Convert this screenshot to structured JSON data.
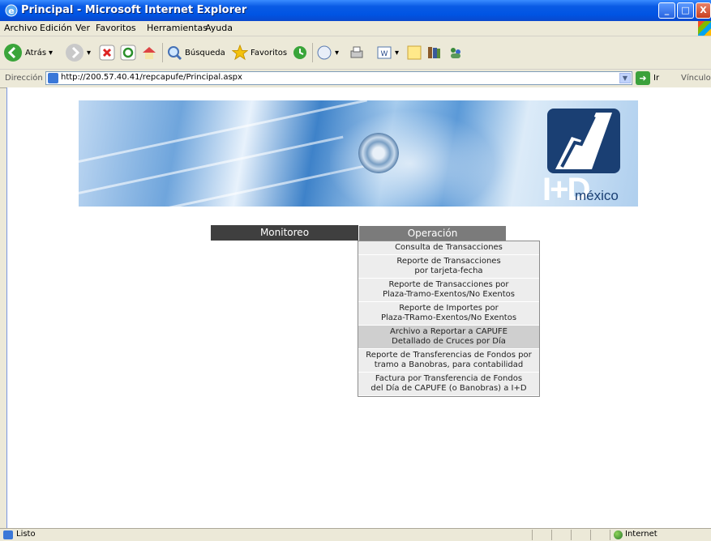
{
  "window": {
    "title": "Principal - Microsoft Internet Explorer",
    "controls": [
      "_",
      "□",
      "X"
    ]
  },
  "menubar": {
    "items": [
      "Archivo",
      "Edición",
      "Ver",
      "Favoritos",
      "Herramientas",
      "Ayuda"
    ]
  },
  "toolbar": {
    "back_label": "Atrás",
    "search_label": "Búsqueda",
    "favorites_label": "Favoritos"
  },
  "address": {
    "label": "Dirección",
    "url": "http://200.57.40.41/repcapufe/Principal.aspx",
    "go_label": "Ir",
    "links_label": "Vínculos"
  },
  "banner": {
    "logo_text": "I+D",
    "logo_sub": "méxico"
  },
  "nav": {
    "tab1": "Monitoreo",
    "tab2": "Operación",
    "dropdown": [
      {
        "line1": "Consulta de Transacciones",
        "line2": ""
      },
      {
        "line1": "Reporte de Transacciones",
        "line2": "por tarjeta-fecha"
      },
      {
        "line1": "Reporte de Transacciones por",
        "line2": "Plaza-Tramo-Exentos/No Exentos"
      },
      {
        "line1": "Reporte de Importes por",
        "line2": "Plaza-TRamo-Exentos/No Exentos"
      },
      {
        "line1": "Archivo a Reportar a CAPUFE",
        "line2": "Detallado de Cruces por Día"
      },
      {
        "line1": "Reporte de Transferencias de Fondos por",
        "line2": "tramo a Banobras, para contabilidad"
      },
      {
        "line1": "Factura por Transferencia de Fondos",
        "line2": "del Día de CAPUFE (o Banobras) a I+D"
      }
    ],
    "highlighted_index": 4
  },
  "status": {
    "text": "Listo",
    "zone": "Internet"
  }
}
